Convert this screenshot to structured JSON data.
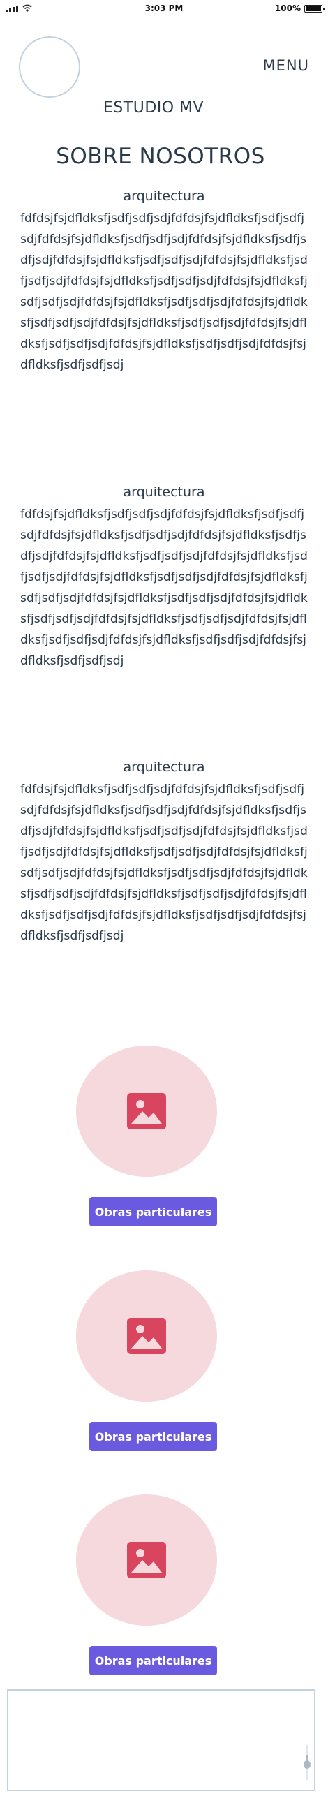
{
  "status_bar": {
    "time": "3:03 PM",
    "battery": "100%",
    "battery_level": 1.0,
    "icons": [
      "signal-icon",
      "wifi-icon",
      "battery-icon"
    ]
  },
  "header": {
    "menu_label": "MENU",
    "brand": "ESTUDIO MV"
  },
  "page_title": "SOBRE NOSOTROS",
  "sections": [
    {
      "heading": "arquitectura",
      "body": "fdfdsjfsjdfldksfjsdfjsdfjsdjfdfdsjfsjdfldksfjsdfjsdfjsdjfdfdsjfsjdfldksfjsdfjsdfjsdjfdfdsjfsjdfldksfjsdfjsdfjsdjfdfdsjfsjdfldksfjsdfjsdfjsdjfdfdsjfsjdfldksfjsdfjsdfjsdjfdfdsjfsjdfldksfjsdfjsdfjsdjfdfdsjfsjdfldksfjsdfjsdfjsdjfdfdsjfsjdfldksfjsdfjsdfjsdjfdfdsjfsjdfldksfjsdfjsdfjsdjfdfdsjfsjdfldksfjsdfjsdfjsdjfdfdsjfsjdfldksfjsdfjsdfjsdjfdfdsjfsjdfldksfjsdfjsdfjsdjfdfdsjfsjdfldksfjsdfjsdfjsdj"
    },
    {
      "heading": "arquitectura",
      "body": "fdfdsjfsjdfldksfjsdfjsdfjsdjfdfdsjfsjdfldksfjsdfjsdfjsdjfdfdsjfsjdfldksfjsdfjsdfjsdjfdfdsjfsjdfldksfjsdfjsdfjsdjfdfdsjfsjdfldksfjsdfjsdfjsdjfdfdsjfsjdfldksfjsdfjsdfjsdjfdfdsjfsjdfldksfjsdfjsdfjsdjfdfdsjfsjdfldksfjsdfjsdfjsdjfdfdsjfsjdfldksfjsdfjsdfjsdjfdfdsjfsjdfldksfjsdfjsdfjsdjfdfdsjfsjdfldksfjsdfjsdfjsdjfdfdsjfsjdfldksfjsdfjsdfjsdjfdfdsjfsjdfldksfjsdfjsdfjsdjfdfdsjfsjdfldksfjsdfjsdfjsdj"
    },
    {
      "heading": "arquitectura",
      "body": "fdfdsjfsjdfldksfjsdfjsdfjsdjfdfdsjfsjdfldksfjsdfjsdfjsdjfdfdsjfsjdfldksfjsdfjsdfjsdjfdfdsjfsjdfldksfjsdfjsdfjsdjfdfdsjfsjdfldksfjsdfjsdfjsdjfdfdsjfsjdfldksfjsdfjsdfjsdjfdfdsjfsjdfldksfjsdfjsdfjsdjfdfdsjfsjdfldksfjsdfjsdfjsdjfdfdsjfsjdfldksfjsdfjsdfjsdjfdfdsjfsjdfldksfjsdfjsdfjsdjfdfdsjfsjdfldksfjsdfjsdfjsdjfdfdsjfsjdfldksfjsdfjsdfjsdjfdfdsjfsjdfldksfjsdfjsdfjsdjfdfdsjfsjdfldksfjsdfjsdfjsdj"
    }
  ],
  "projects": [
    {
      "button_label": "Obras particulares",
      "icon": "image-icon"
    },
    {
      "button_label": "Obras particulares",
      "icon": "image-icon"
    },
    {
      "button_label": "Obras particulares",
      "icon": "image-icon"
    }
  ],
  "colors": {
    "text": "#2b3a4b",
    "accent_button": "#6a5ae0",
    "image_placeholder_bg": "#f6d9dd",
    "image_icon": "#d9455f",
    "outline": "#c4d1de"
  }
}
